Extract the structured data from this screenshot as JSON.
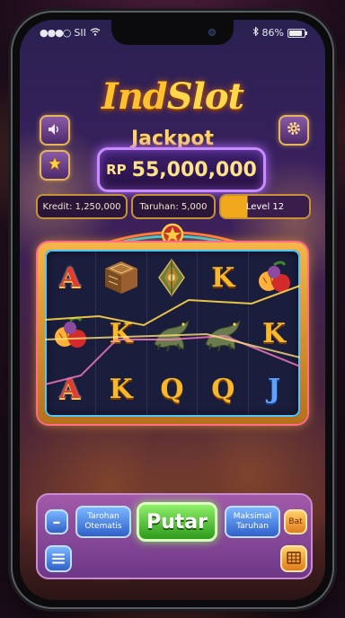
{
  "status": {
    "signal_text": "SII",
    "battery_percent": "86%",
    "battery_level": 0.86
  },
  "game": {
    "logo_part1": "Ind",
    "logo_part2": "Slot",
    "jackpot_label": "Jackpot",
    "jackpot_currency": "RP",
    "jackpot_amount": "55,000,000"
  },
  "info_bar": {
    "credit": "Kredit: 1,250,000",
    "bet": "Taruhan: 5,000",
    "level": "Level 12"
  },
  "reels": [
    [
      "A",
      "batik-icon",
      "wayang-icon",
      "K",
      "fruit-icon"
    ],
    [
      "fruit-icon",
      "K",
      "komodo-icon",
      "komodo-icon",
      "K"
    ],
    [
      "A",
      "K",
      "Q",
      "Q",
      "J"
    ]
  ],
  "controls": {
    "minus": "–",
    "auto": "Tarohan Otematis",
    "spin": "Putar",
    "max": "Maksimal Taruhan",
    "bet_small": "Bat"
  }
}
